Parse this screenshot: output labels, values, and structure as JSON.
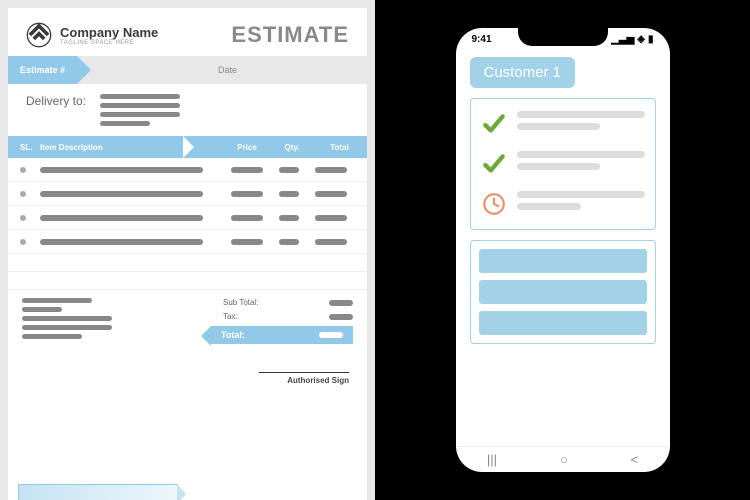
{
  "company": {
    "name": "Company Name",
    "tagline": "TAGLINE SPACE HERE"
  },
  "title": "ESTIMATE",
  "labels": {
    "estimate_no": "Estimate #",
    "date": "Date",
    "delivery": "Delivery to:",
    "sl": "SL.",
    "desc": "Item Description",
    "price": "Price",
    "qty": "Qty.",
    "total_col": "Total",
    "subtotal": "Sub Total:",
    "tax": "Tax:",
    "total": "Total:",
    "sign": "Authorised Sign"
  },
  "phone": {
    "time": "9:41",
    "customer": "Customer 1",
    "nav": {
      "recent": "|||",
      "home": "○",
      "back": "<"
    }
  },
  "colors": {
    "accent": "#92c9e8",
    "gray": "#888"
  }
}
